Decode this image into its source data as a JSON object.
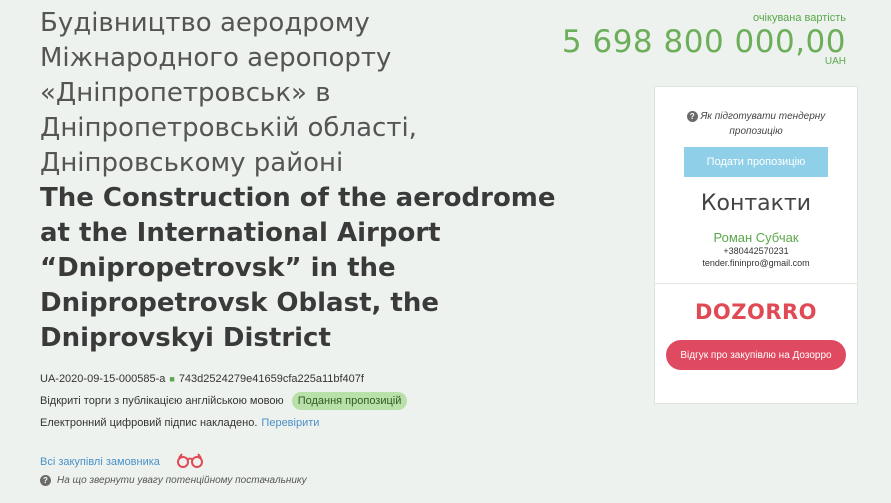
{
  "title_ua_lines": [
    "Будівництво аеродрому",
    "Міжнародного аеропорту",
    "«Дніпропетровськ» в",
    "Дніпропетровській області,",
    "Дніпровському районі"
  ],
  "title_en_lines": [
    "The Construction of the aerodrome",
    "at the International Airport",
    "“Dnipropetrovsk” in the",
    "Dnipropetrovsk Oblast, the",
    "Dniprovskyi District"
  ],
  "tender_id": "UA-2020-09-15-000585-a",
  "tender_hash": "743d2524279e41659cfa225a11bf407f",
  "procedure_text": "Відкриті торги з публікацією англійською мовою",
  "status_badge": "Подання пропозицій",
  "signature_text": "Електронний цифровий підпис накладено.",
  "verify_link": "Перевірити",
  "all_tenders_link": "Всі закупівлі замовника",
  "attention_text": "На що звернути увагу потенційному постачальнику",
  "price": {
    "label": "очікувана вартість",
    "value": "5 698 800 000,00",
    "currency": "UAH"
  },
  "sidebar": {
    "howto_text": "Як підготувати тендерну пропозицію",
    "submit_label": "Подати пропозицію",
    "contacts_title": "Контакти",
    "contact_name": "Роман Субчак",
    "contact_phone": "+380442570231",
    "contact_email": "tender.fininpro@gmail.com",
    "dozorro_logo": "DOZORRO",
    "review_label": "Відгук про закупівлю на Дозорро"
  },
  "colors": {
    "accent_green": "#5aa84a",
    "submit_blue": "#8fcfe8",
    "dozorro_red": "#e04a55"
  }
}
